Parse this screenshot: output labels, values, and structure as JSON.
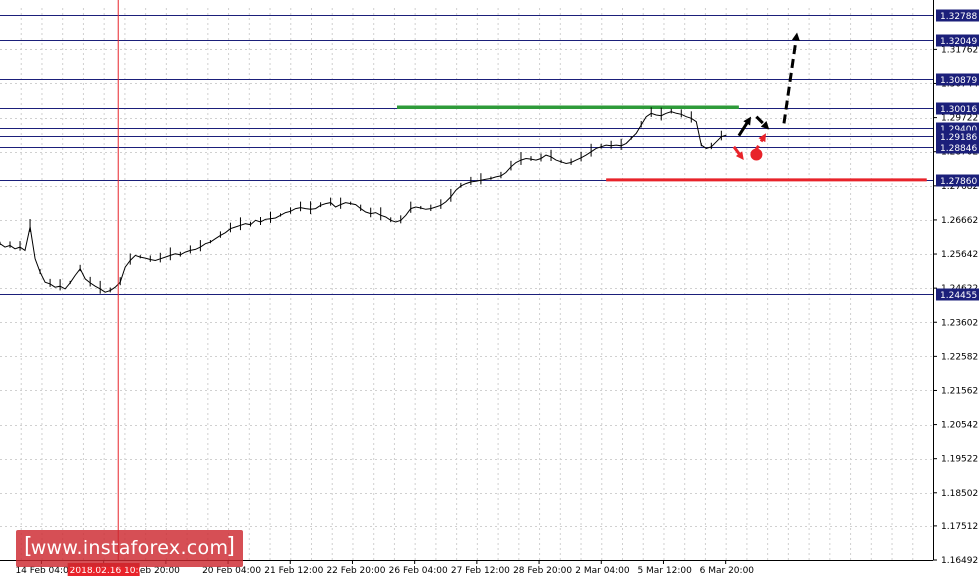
{
  "chart_data": {
    "type": "line",
    "title": "",
    "xlabel": "",
    "ylabel": "",
    "ylim": [
      1.16492,
      1.33
    ],
    "x_labels": [
      "14 Feb 04:00",
      "2018.02.16 10:00",
      "eb 20:00",
      "20 Feb 04:00",
      "21 Feb 12:00",
      "22 Feb 20:00",
      "26 Feb 04:00",
      "27 Feb 12:00",
      "28 Feb 20:00",
      "2 Mar 04:00",
      "5 Mar 12:00",
      "6 Mar 20:00"
    ],
    "x_label_slots": [
      2,
      5,
      8,
      11,
      14,
      17,
      20,
      23,
      26,
      29,
      32,
      35
    ],
    "x_slots_total": 45,
    "y_ticks": [
      "1.31762",
      "1.30744",
      "1.29722",
      "1.28702",
      "1.27682",
      "1.26662",
      "1.25642",
      "1.24622",
      "1.23602",
      "1.22582",
      "1.21562",
      "1.20542",
      "1.19522",
      "1.18502",
      "1.17512",
      "1.16492"
    ],
    "y_tick_values": [
      1.31762,
      1.30744,
      1.29722,
      1.28702,
      1.27682,
      1.26662,
      1.25642,
      1.24622,
      1.23602,
      1.22582,
      1.21562,
      1.20542,
      1.19522,
      1.18502,
      1.17512,
      1.16492
    ],
    "levels": [
      {
        "label": "1.32788",
        "value": 1.32788
      },
      {
        "label": "1.32049",
        "value": 1.32049
      },
      {
        "label": "1.30879",
        "value": 1.30879
      },
      {
        "label": "1.30016",
        "value": 1.30016
      },
      {
        "label": "1.29400",
        "value": 1.294
      },
      {
        "label": "1.29186",
        "value": 1.29186
      },
      {
        "label": "1.28846",
        "value": 1.28846
      },
      {
        "label": "1.27860",
        "value": 1.2786
      },
      {
        "label": "1.24455",
        "value": 1.24455
      }
    ],
    "price_series": [
      [
        0.0,
        1.2595
      ],
      [
        0.4,
        1.2585
      ],
      [
        0.8,
        1.259
      ],
      [
        1.2,
        1.258
      ],
      [
        1.6,
        1.2585
      ],
      [
        2.0,
        1.2575
      ],
      [
        2.4,
        1.2645
      ],
      [
        2.8,
        1.255
      ],
      [
        3.2,
        1.251
      ],
      [
        3.6,
        1.248
      ],
      [
        4.0,
        1.2475
      ],
      [
        4.4,
        1.2465
      ],
      [
        4.8,
        1.2468
      ],
      [
        5.2,
        1.246
      ],
      [
        5.6,
        1.2478
      ],
      [
        6.0,
        1.25
      ],
      [
        6.4,
        1.252
      ],
      [
        6.8,
        1.249
      ],
      [
        7.2,
        1.2478
      ],
      [
        7.6,
        1.2468
      ],
      [
        8.0,
        1.246
      ],
      [
        8.4,
        1.245
      ],
      [
        8.8,
        1.2455
      ],
      [
        9.2,
        1.2465
      ],
      [
        9.6,
        1.248
      ],
      [
        10.0,
        1.2525
      ],
      [
        10.4,
        1.2545
      ],
      [
        10.8,
        1.256
      ],
      [
        11.2,
        1.2555
      ],
      [
        11.6,
        1.2552
      ],
      [
        12.0,
        1.2548
      ],
      [
        12.4,
        1.2545
      ],
      [
        12.8,
        1.255
      ],
      [
        13.2,
        1.2555
      ],
      [
        13.6,
        1.256
      ],
      [
        14.0,
        1.2565
      ],
      [
        14.4,
        1.2562
      ],
      [
        14.8,
        1.257
      ],
      [
        15.2,
        1.2575
      ],
      [
        15.6,
        1.2578
      ],
      [
        16.0,
        1.2585
      ],
      [
        16.4,
        1.2595
      ],
      [
        16.8,
        1.26
      ],
      [
        17.2,
        1.261
      ],
      [
        17.6,
        1.262
      ],
      [
        18.0,
        1.2628
      ],
      [
        18.4,
        1.264
      ],
      [
        18.8,
        1.2645
      ],
      [
        19.2,
        1.265
      ],
      [
        19.6,
        1.2655
      ],
      [
        20.0,
        1.2652
      ],
      [
        20.4,
        1.2665
      ],
      [
        20.8,
        1.266
      ],
      [
        21.2,
        1.2668
      ],
      [
        21.6,
        1.267
      ],
      [
        22.0,
        1.2672
      ],
      [
        22.4,
        1.268
      ],
      [
        22.8,
        1.2688
      ],
      [
        23.2,
        1.2692
      ],
      [
        23.6,
        1.27
      ],
      [
        24.0,
        1.2703
      ],
      [
        24.4,
        1.27
      ],
      [
        24.8,
        1.2698
      ],
      [
        25.2,
        1.27
      ],
      [
        25.6,
        1.271
      ],
      [
        26.0,
        1.2715
      ],
      [
        26.4,
        1.2718
      ],
      [
        26.8,
        1.2705
      ],
      [
        27.2,
        1.2712
      ],
      [
        27.6,
        1.2718
      ],
      [
        28.0,
        1.2715
      ],
      [
        28.4,
        1.2712
      ],
      [
        28.8,
        1.27
      ],
      [
        29.2,
        1.269
      ],
      [
        29.6,
        1.2685
      ],
      [
        30.0,
        1.2688
      ],
      [
        30.4,
        1.268
      ],
      [
        30.8,
        1.2675
      ],
      [
        31.2,
        1.2665
      ],
      [
        31.6,
        1.266
      ],
      [
        32.0,
        1.2665
      ],
      [
        32.4,
        1.268
      ],
      [
        32.8,
        1.27
      ],
      [
        33.2,
        1.2705
      ],
      [
        33.6,
        1.2702
      ],
      [
        34.0,
        1.2698
      ],
      [
        34.4,
        1.27
      ],
      [
        34.8,
        1.2705
      ],
      [
        35.2,
        1.271
      ],
      [
        35.6,
        1.272
      ],
      [
        36.0,
        1.2735
      ],
      [
        36.4,
        1.2755
      ],
      [
        36.8,
        1.2768
      ],
      [
        37.2,
        1.2775
      ],
      [
        37.6,
        1.278
      ],
      [
        38.0,
        1.2782
      ],
      [
        38.4,
        1.2785
      ],
      [
        38.8,
        1.2788
      ],
      [
        39.2,
        1.279
      ],
      [
        39.6,
        1.2795
      ],
      [
        40.0,
        1.2798
      ],
      [
        40.4,
        1.2808
      ],
      [
        40.8,
        1.2825
      ],
      [
        41.2,
        1.2838
      ],
      [
        41.6,
        1.2845
      ],
      [
        42.0,
        1.285
      ],
      [
        42.4,
        1.2848
      ],
      [
        42.8,
        1.2845
      ],
      [
        43.2,
        1.285
      ],
      [
        43.6,
        1.286
      ],
      [
        44.0,
        1.2855
      ],
      [
        44.4,
        1.2845
      ],
      [
        44.8,
        1.284
      ],
      [
        45.2,
        1.2835
      ],
      [
        45.6,
        1.2838
      ],
      [
        46.0,
        1.2845
      ],
      [
        46.4,
        1.2852
      ],
      [
        46.8,
        1.286
      ],
      [
        47.2,
        1.287
      ],
      [
        47.6,
        1.288
      ],
      [
        48.0,
        1.2885
      ],
      [
        48.4,
        1.289
      ],
      [
        48.8,
        1.2888
      ],
      [
        49.2,
        1.289
      ],
      [
        49.6,
        1.2888
      ],
      [
        50.0,
        1.2895
      ],
      [
        50.4,
        1.291
      ],
      [
        50.8,
        1.2925
      ],
      [
        51.2,
        1.295
      ],
      [
        51.6,
        1.2975
      ],
      [
        52.0,
        1.2985
      ],
      [
        52.4,
        1.298
      ],
      [
        52.8,
        1.2978
      ],
      [
        53.2,
        1.2985
      ],
      [
        53.6,
        1.299
      ],
      [
        54.0,
        1.2985
      ],
      [
        54.4,
        1.2982
      ],
      [
        54.8,
        1.2975
      ],
      [
        55.2,
        1.297
      ],
      [
        55.6,
        1.296
      ],
      [
        56.0,
        1.289
      ],
      [
        56.4,
        1.288
      ],
      [
        56.8,
        1.2885
      ],
      [
        57.2,
        1.29
      ],
      [
        57.6,
        1.2915
      ],
      [
        58.0,
        1.292
      ]
    ],
    "projection_arrows": [
      {
        "color": "#000000",
        "style": "solid",
        "from": [
          59.0,
          1.2918
        ],
        "to": [
          59.8,
          1.2965
        ]
      },
      {
        "color": "#000000",
        "style": "dashed",
        "from": [
          60.4,
          1.2975
        ],
        "to": [
          61.2,
          1.2945
        ]
      },
      {
        "color": "#000000",
        "style": "dashed",
        "from": [
          62.6,
          1.2955
        ],
        "to": [
          63.6,
          1.3215
        ]
      },
      {
        "color": "#e8232a",
        "style": "dashed",
        "from": [
          58.6,
          1.2885
        ],
        "to": [
          59.2,
          1.2855
        ]
      },
      {
        "color": "#e8232a",
        "style": "dashed",
        "from": [
          60.2,
          1.2865
        ],
        "to": [
          61.0,
          1.2915
        ]
      }
    ],
    "marker_point": {
      "color": "#e8232a",
      "x": 60.4,
      "y": 1.2862
    },
    "support_line": {
      "color": "#e8232a",
      "from_x": 48.4,
      "to_x": 74.0,
      "value": 1.2786
    },
    "resistance_line": {
      "color": "#2e9b3a",
      "from_x": 31.7,
      "to_x": 59.0,
      "value": 1.3003
    },
    "cursor_x": 9.4,
    "grid": "dotted",
    "x_range": [
      0,
      74.5
    ]
  },
  "watermark": {
    "text": "www.instaforex.com"
  },
  "colors": {
    "grid": "#d0d0d0",
    "levels": "#1b1f7a",
    "price": "#000000",
    "cursor": "#e8232a",
    "cursor_label": "#e8232a",
    "panel_bg": "#ffffff"
  }
}
